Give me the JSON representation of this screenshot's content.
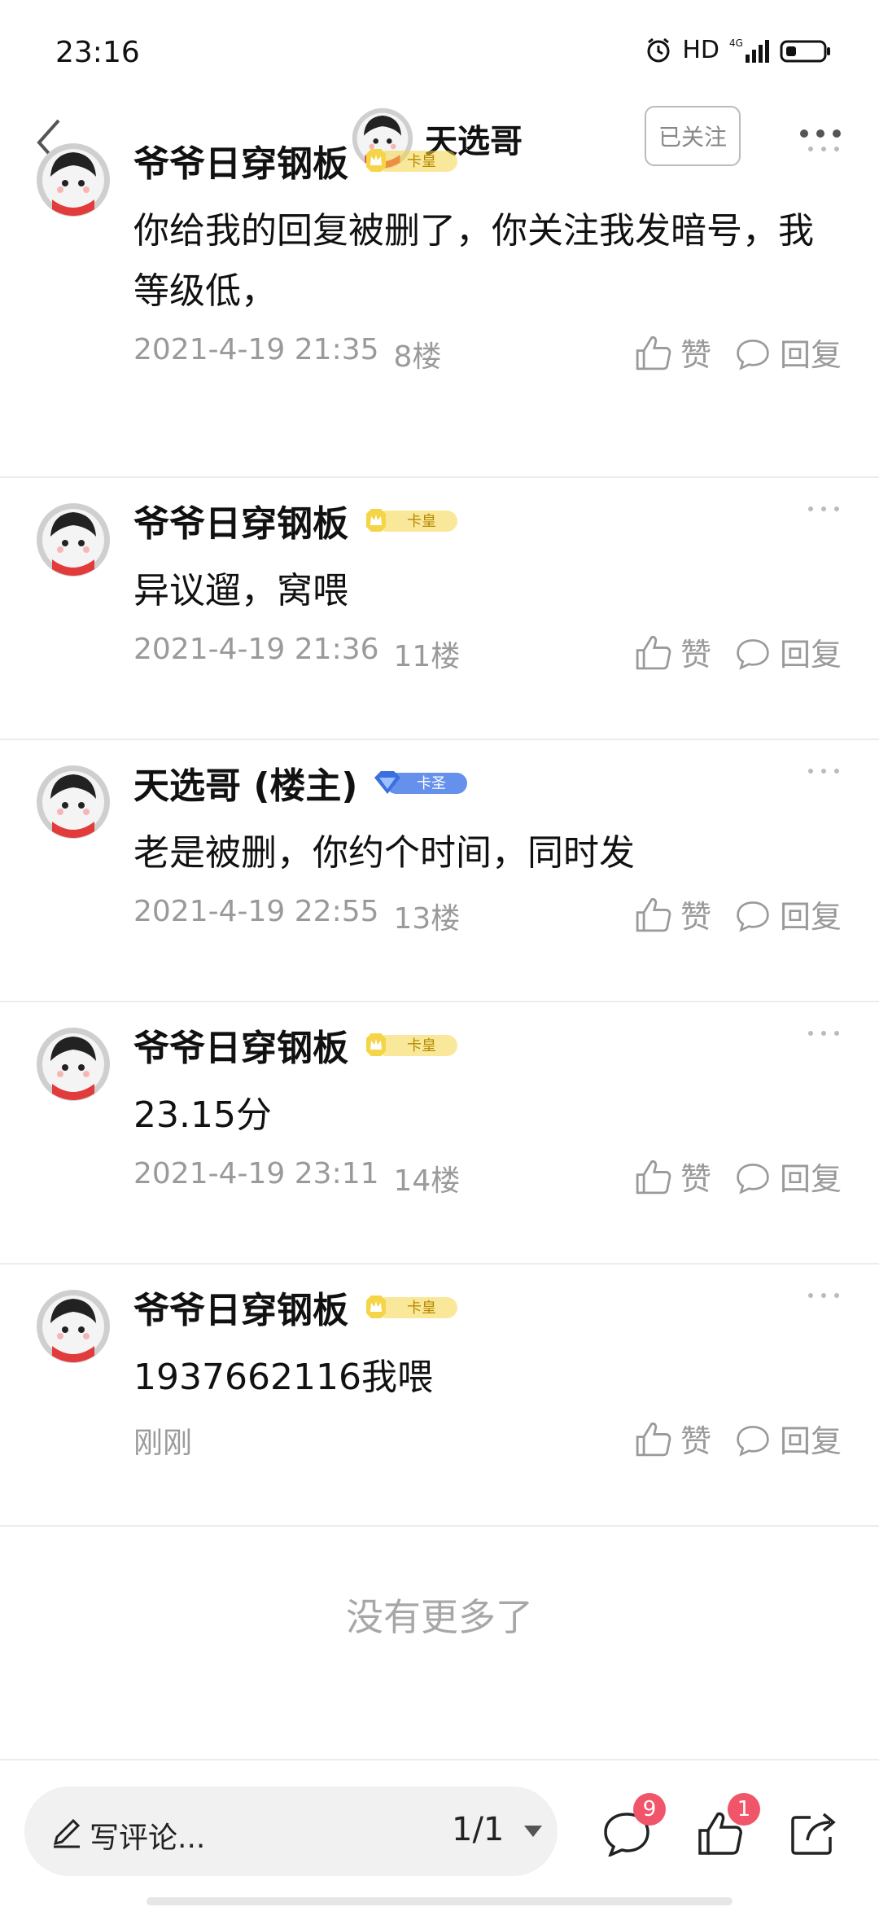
{
  "status_bar": {
    "time": "23:16",
    "hd": "HD",
    "network": "4G"
  },
  "header": {
    "title": "天选哥",
    "follow_label": "已关注"
  },
  "comments": [
    {
      "name": "爷爷日穿钢板",
      "badge": "卡皇",
      "badge_type": "gold",
      "content": "你给我的回复被删了，你关注我发暗号，我等级低，",
      "time": "2021-4-19 21:35",
      "floor": "8楼",
      "like_label": "赞",
      "reply_label": "回复"
    },
    {
      "name": "爷爷日穿钢板",
      "badge": "卡皇",
      "badge_type": "gold",
      "content": "异议遛，窝喂",
      "time": "2021-4-19 21:36",
      "floor": "11楼",
      "like_label": "赞",
      "reply_label": "回复"
    },
    {
      "name": "天选哥 (楼主)",
      "badge": "卡圣",
      "badge_type": "blue",
      "content": "老是被删，你约个时间，同时发",
      "time": "2021-4-19 22:55",
      "floor": "13楼",
      "like_label": "赞",
      "reply_label": "回复"
    },
    {
      "name": "爷爷日穿钢板",
      "badge": "卡皇",
      "badge_type": "gold",
      "content": "23.15分",
      "time": "2021-4-19 23:11",
      "floor": "14楼",
      "like_label": "赞",
      "reply_label": "回复"
    },
    {
      "name": "爷爷日穿钢板",
      "badge": "卡皇",
      "badge_type": "gold",
      "content": "1937662116我喂",
      "time": "刚刚",
      "floor": "",
      "like_label": "赞",
      "reply_label": "回复"
    }
  ],
  "footer": {
    "no_more": "没有更多了",
    "write_placeholder": "写评论...",
    "pager": "1/1",
    "comment_count": "9",
    "like_count": "1"
  },
  "colors": {
    "badge_red": "#f0556a",
    "meta_gray": "#9a9a9a",
    "gold": "#f5d547",
    "blue": "#4a7de8"
  }
}
